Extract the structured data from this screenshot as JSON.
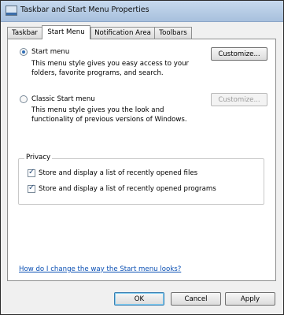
{
  "window": {
    "title": "Taskbar and Start Menu Properties"
  },
  "tabs": [
    {
      "label": "Taskbar"
    },
    {
      "label": "Start Menu"
    },
    {
      "label": "Notification Area"
    },
    {
      "label": "Toolbars"
    }
  ],
  "start_menu": {
    "label": "Start menu",
    "selected": true,
    "desc1": "This menu style gives you easy access to your",
    "desc2": "folders, favorite programs, and search.",
    "customize_label": "Customize..."
  },
  "classic_menu": {
    "label": "Classic Start menu",
    "selected": false,
    "desc1": "This menu style gives you the look and",
    "desc2": "functionality of previous versions of Windows.",
    "customize_label": "Customize..."
  },
  "privacy": {
    "title": "Privacy",
    "files_label": "Store and display a list of recently opened files",
    "programs_label": "Store and display a list of recently opened programs"
  },
  "help_link": "How do I change the way the Start menu looks?",
  "footer": {
    "ok_label": "OK",
    "cancel_label": "Cancel",
    "apply_label": "Apply"
  }
}
